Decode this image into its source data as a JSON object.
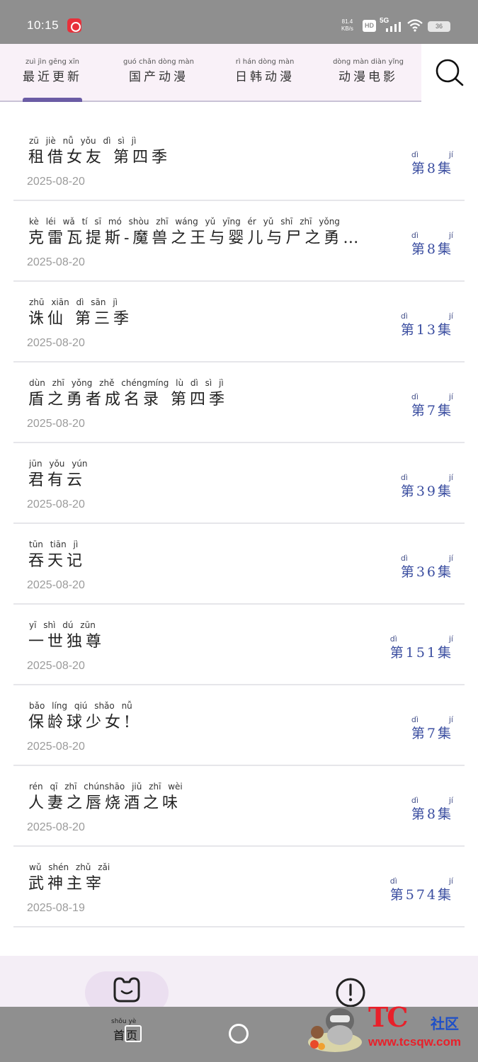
{
  "status_bar": {
    "time": "10:15",
    "net_speed_value": "81.4",
    "net_speed_unit": "KB/s",
    "hd": "HD",
    "network": "5G",
    "battery": "36",
    "icons": [
      "netease-music-icon",
      "signal-icon",
      "wifi-icon",
      "battery-icon"
    ]
  },
  "tabs": [
    {
      "pinyin": "zuì jìn gēng xīn",
      "label": "最近更新",
      "active": true
    },
    {
      "pinyin": "guó chǎn dòng màn",
      "label": "国产动漫",
      "active": false
    },
    {
      "pinyin": "rì hán dòng màn",
      "label": "日韩动漫",
      "active": false
    },
    {
      "pinyin": "dòng màn diàn yǐng",
      "label": "动漫电影",
      "active": false
    }
  ],
  "accent_color": "#6b5ca5",
  "episode_color": "#3b4ea0",
  "items": [
    {
      "pinyin": "zū jiè nǚ yǒu  dì sì jì",
      "title": "租借女友 第四季",
      "date": "2025-08-20",
      "ep_py_1": "dì",
      "ep_py_2": "jí",
      "episode": "第8集"
    },
    {
      "pinyin": "kè léi wǎ tí sī  mó shòu zhī wáng yǔ yīng ér yǔ shī zhī yǒng",
      "title": "克雷瓦提斯-魔兽之王与婴儿与尸之勇…",
      "date": "2025-08-20",
      "ep_py_1": "dì",
      "ep_py_2": "jí",
      "episode": "第8集"
    },
    {
      "pinyin": "zhū xiān  dì sān jì",
      "title": "诛仙 第三季",
      "date": "2025-08-20",
      "ep_py_1": "dì",
      "ep_py_2": "jí",
      "episode": "第13集"
    },
    {
      "pinyin": "dùn zhī yǒng zhě chéngmíng lù  dì sì jì",
      "title": "盾之勇者成名录 第四季",
      "date": "2025-08-20",
      "ep_py_1": "dì",
      "ep_py_2": "jí",
      "episode": "第7集"
    },
    {
      "pinyin": "jūn yǒu yún",
      "title": "君有云",
      "date": "2025-08-20",
      "ep_py_1": "dì",
      "ep_py_2": "jí",
      "episode": "第39集"
    },
    {
      "pinyin": "tūn tiān jì",
      "title": "吞天记",
      "date": "2025-08-20",
      "ep_py_1": "dì",
      "ep_py_2": "jí",
      "episode": "第36集"
    },
    {
      "pinyin": "yī shì dú zūn",
      "title": "一世独尊",
      "date": "2025-08-20",
      "ep_py_1": "dì",
      "ep_py_2": "jí",
      "episode": "第151集"
    },
    {
      "pinyin": "bǎo líng qiú shǎo nǚ",
      "title": "保龄球少女!",
      "date": "2025-08-20",
      "ep_py_1": "dì",
      "ep_py_2": "jí",
      "episode": "第7集"
    },
    {
      "pinyin": "rén qī zhī chúnshāo jiǔ zhī wèi",
      "title": "人妻之唇烧酒之味",
      "date": "2025-08-20",
      "ep_py_1": "dì",
      "ep_py_2": "jí",
      "episode": "第8集"
    },
    {
      "pinyin": "wǔ shén zhǔ zǎi",
      "title": "武神主宰",
      "date": "2025-08-19",
      "ep_py_1": "dì",
      "ep_py_2": "jí",
      "episode": "第574集"
    }
  ],
  "bottom_nav": {
    "home_pinyin": "shǒu yè",
    "home_label": "首页",
    "icons": [
      "frog-home-icon",
      "info-icon"
    ]
  },
  "watermark": {
    "brand": "TC",
    "community": "社区",
    "url": "www.tcsqw.com"
  }
}
